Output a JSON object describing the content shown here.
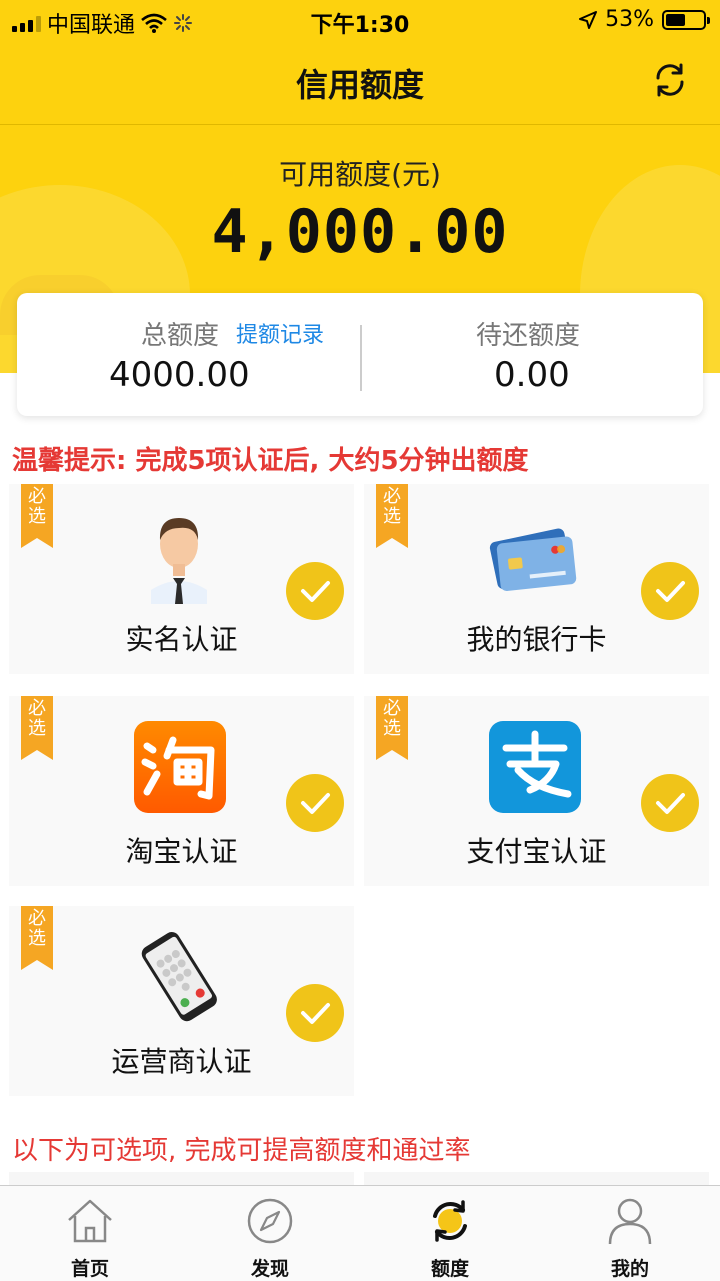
{
  "status_bar": {
    "carrier": "中国联通",
    "time": "下午1:30",
    "battery": "53%",
    "battery_level": 0.53,
    "icons": [
      "signal-icon",
      "wifi-icon",
      "loading-icon",
      "location-arrow-icon",
      "battery-icon"
    ]
  },
  "nav": {
    "title": "信用额度",
    "refresh_icon": "refresh-icon"
  },
  "hero": {
    "label": "可用额度(元)",
    "amount": "4,000.00"
  },
  "summary": {
    "total_label": "总额度",
    "record_link": "提额记录",
    "total_value": "4000.00",
    "pending_label": "待还额度",
    "pending_value": "0.00"
  },
  "tip": "温馨提示: 完成5项认证后, 大约5分钟出额度",
  "cards": [
    {
      "badge": "必选",
      "name": "实名认证",
      "icon": "person-icon",
      "done": true
    },
    {
      "badge": "必选",
      "name": "我的银行卡",
      "icon": "bank-card-icon",
      "done": true
    },
    {
      "badge": "必选",
      "name": "淘宝认证",
      "icon": "taobao-icon",
      "done": true
    },
    {
      "badge": "必选",
      "name": "支付宝认证",
      "icon": "alipay-icon",
      "done": true
    },
    {
      "badge": "必选",
      "name": "运营商认证",
      "icon": "phone-icon",
      "done": true
    }
  ],
  "optional_note": "以下为可选项, 完成可提高额度和通过率",
  "tabs": [
    {
      "label": "首页",
      "icon": "home-icon"
    },
    {
      "label": "发现",
      "icon": "compass-icon"
    },
    {
      "label": "额度",
      "icon": "quota-icon",
      "active": true
    },
    {
      "label": "我的",
      "icon": "user-icon"
    }
  ],
  "colors": {
    "brand_yellow": "#fdd20e",
    "check_yellow": "#f0c419",
    "badge_orange": "#f5a623",
    "tip_red": "#e53935",
    "link_blue": "#1e88e5"
  }
}
